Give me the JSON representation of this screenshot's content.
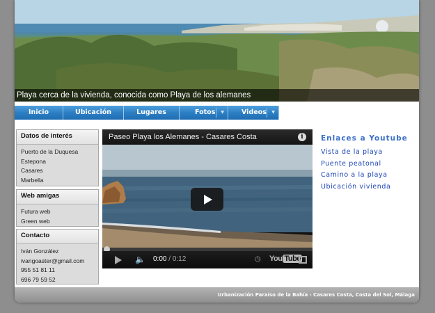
{
  "banner": {
    "caption": "Playa cerca de la vivienda, conocida como Playa de los alemanes"
  },
  "nav": {
    "items": [
      {
        "label": "Inicio",
        "has_dropdown": false
      },
      {
        "label": "Ubicación",
        "has_dropdown": false
      },
      {
        "label": "Lugares",
        "has_dropdown": false
      },
      {
        "label": "Fotos",
        "has_dropdown": true
      },
      {
        "label": "Videos",
        "has_dropdown": true
      }
    ]
  },
  "sidebar": {
    "interes": {
      "title": "Datos de interés",
      "items": [
        "Puerto de la Duquesa",
        "Estepona",
        "Casares",
        "Marbella"
      ]
    },
    "amigas": {
      "title": "Web amigas",
      "items": [
        "Futura web",
        "Green web"
      ]
    },
    "contacto": {
      "title": "Contacto",
      "items": [
        "Iván González",
        "ivangoaster@gmail.com",
        "955 51 81 11",
        "696 79 59 52"
      ]
    }
  },
  "video": {
    "title": "Paseo Playa los Alemanes - Casares Costa",
    "current_time": "0:00",
    "separator": " / ",
    "duration": "0:12",
    "brand_you": "You",
    "brand_tube": "Tube",
    "progress": 0
  },
  "links": {
    "title": "Enlaces a Youtube",
    "items": [
      "Vista de la playa",
      "Puente peatonal",
      "Camino a la playa",
      "Ubicación vivienda"
    ]
  },
  "footer": {
    "text": "Urbanización Paraíso de la Bahía - Casares Costa, Costa del Sol, Málaga"
  },
  "colors": {
    "nav_blue": "#2d7fc4",
    "link_blue": "#1f46b8",
    "title_blue": "#3b6fc7",
    "page_bg": "#8e8e8e"
  },
  "icons": {
    "info": "info-icon",
    "play": "play-icon",
    "volume": "volume-icon",
    "settings": "clock-icon",
    "fullscreen": "fullscreen-icon",
    "dropdown": "chevron-down-icon"
  }
}
